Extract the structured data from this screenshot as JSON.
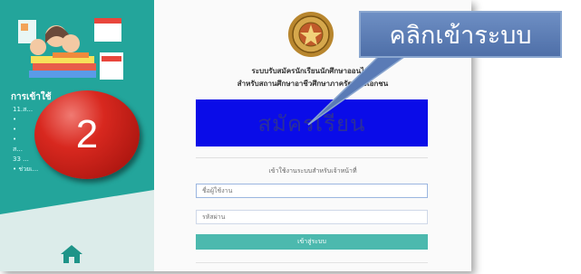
{
  "sidebar": {
    "heading": "การเข้าใช้",
    "lines": [
      "11.ส...",
      "•",
      "•",
      "•",
      "ส...",
      "33 ...",
      "• ช่วยเ..."
    ],
    "home_icon": "home-icon"
  },
  "main": {
    "seal_icon": "thai-seal-emblem",
    "title_line1": "ระบบรับสมัครนักเรียนนักศึกษาออนไลน์",
    "title_line2": "สำหรับสถานศึกษาอาชีวศึกษาภาครัฐ และเอกชน",
    "register_button": "สมัครเรียน",
    "login_heading": "เข้าใช้งานระบบสำหรับเจ้าหน้าที่",
    "username_placeholder": "ชื่อผู้ใช้งาน",
    "password_placeholder": "รหัสผ่าน",
    "login_button": "เข้าสู่ระบบ"
  },
  "annotation": {
    "step_number": "2",
    "callout_text": "คลิกเข้าระบบ"
  },
  "colors": {
    "sidebar": "#23a59b",
    "register": "#0a0ce8",
    "login": "#4cb9ae",
    "badge": "#d8281f",
    "callout": "#5a7bb6"
  }
}
